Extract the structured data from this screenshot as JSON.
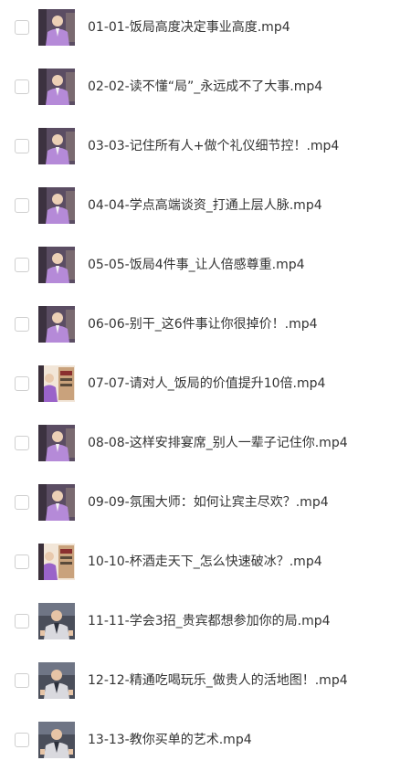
{
  "files": [
    {
      "name": "01-01-饭局高度决定事业高度.mp4",
      "thumb": "a"
    },
    {
      "name": "02-02-读不懂“局”_永远成不了大事.mp4",
      "thumb": "a"
    },
    {
      "name": "03-03-记住所有人+做个礼仪细节控！.mp4",
      "thumb": "a"
    },
    {
      "name": "04-04-学点高端谈资_打通上层人脉.mp4",
      "thumb": "a"
    },
    {
      "name": "05-05-饭局4件事_让人倍感尊重.mp4",
      "thumb": "a"
    },
    {
      "name": "06-06-别干_这6件事让你很掉价！.mp4",
      "thumb": "a"
    },
    {
      "name": "07-07-请对人_饭局的价值提升10倍.mp4",
      "thumb": "b"
    },
    {
      "name": "08-08-这样安排宴席_别人一辈子记住你.mp4",
      "thumb": "a"
    },
    {
      "name": "09-09-氛围大师：如何让宾主尽欢？.mp4",
      "thumb": "a"
    },
    {
      "name": "10-10-杯酒走天下_怎么快速破冰？.mp4",
      "thumb": "b"
    },
    {
      "name": "11-11-学会3招_贵宾都想参加你的局.mp4",
      "thumb": "c"
    },
    {
      "name": "12-12-精通吃喝玩乐_做贵人的活地图！.mp4",
      "thumb": "c"
    },
    {
      "name": "13-13-教你买单的艺术.mp4",
      "thumb": "c"
    }
  ],
  "colors": {
    "text": "#333333",
    "checkbox_border": "#cfcfcf",
    "thumb_purple": "#b58ad8",
    "thumb_dark": "#2b2f3a"
  }
}
